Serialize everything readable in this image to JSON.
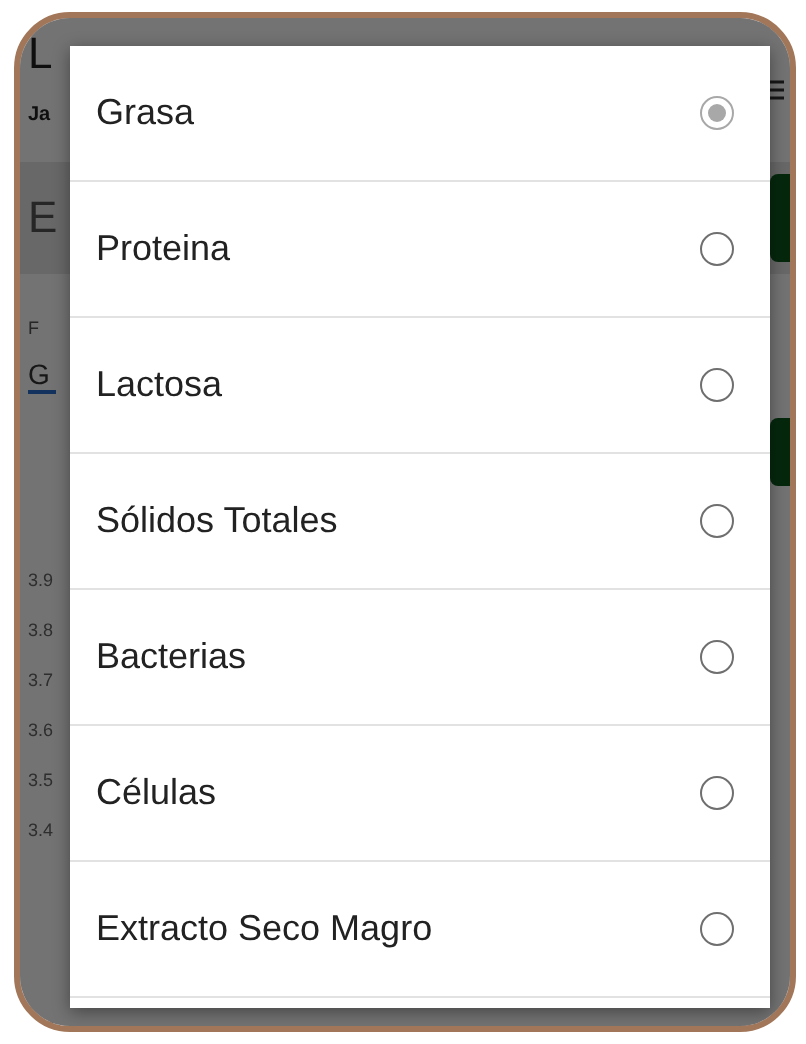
{
  "background": {
    "title": "L",
    "subtitle": "Ja",
    "section": "E",
    "field_label": "F",
    "field_value": "G",
    "y_axis_labels": [
      "3.9",
      "3.8",
      "3.7",
      "3.6",
      "3.5",
      "3.4"
    ]
  },
  "dialog": {
    "options": [
      {
        "label": "Grasa",
        "selected": true
      },
      {
        "label": "Proteina",
        "selected": false
      },
      {
        "label": "Lactosa",
        "selected": false
      },
      {
        "label": "Sólidos Totales",
        "selected": false
      },
      {
        "label": "Bacterias",
        "selected": false
      },
      {
        "label": "Células",
        "selected": false
      },
      {
        "label": "Extracto Seco Magro",
        "selected": false
      }
    ]
  }
}
